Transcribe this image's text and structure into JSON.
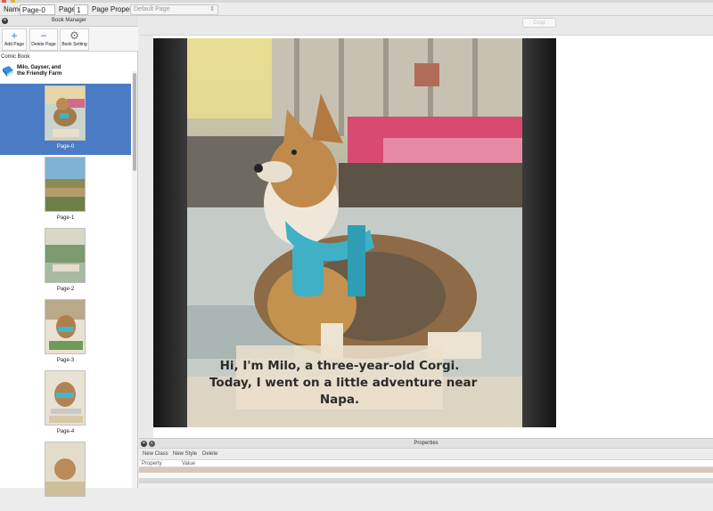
{
  "property_bar": {
    "name_label": "Name",
    "name_value": "Page-0",
    "page_label": "Page",
    "page_value": "1",
    "page_property_label": "Page Property",
    "page_property_value": "Default Page"
  },
  "book_manager": {
    "title": "Book Manager",
    "toolbar": {
      "add_page": "Add Page",
      "delete_page": "Delete Page",
      "book_setting": "Book Setting"
    },
    "book_label": "Comic Book",
    "book_title_line1": "Milo, Gayser, and",
    "book_title_line2": "the Friendly Farm",
    "pages": [
      {
        "label": "Page-0",
        "selected": true
      },
      {
        "label": "Page-1",
        "selected": false
      },
      {
        "label": "Page-2",
        "selected": false
      },
      {
        "label": "Page-3",
        "selected": false
      },
      {
        "label": "Page-4",
        "selected": false
      },
      {
        "label": "",
        "selected": false
      }
    ]
  },
  "canvas": {
    "top_button": "Crop",
    "caption_line1": "Hi, I'm Milo, a three-year-old Corgi.",
    "caption_line2": "Today, I went on a little adventure near",
    "caption_line3": "Napa."
  },
  "properties_panel": {
    "title": "Properties",
    "new_class": "New Class",
    "new_style": "New Style",
    "delete": "Delete",
    "col_property": "Property",
    "col_value": "Value"
  },
  "colors": {
    "selection": "#4a7bc4",
    "accent_icon": "#2d7fd2"
  }
}
